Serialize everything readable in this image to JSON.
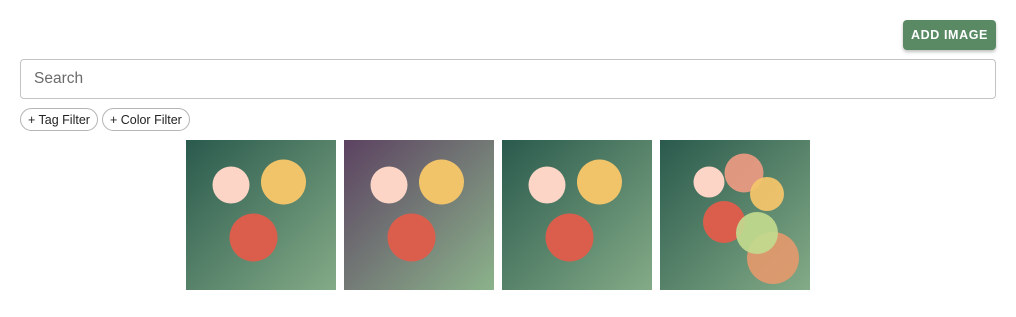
{
  "toolbar": {
    "add_image_label": "ADD IMAGE"
  },
  "search": {
    "placeholder": "Search",
    "value": ""
  },
  "filters": [
    {
      "label": "+ Tag Filter"
    },
    {
      "label": "+ Color Filter"
    }
  ],
  "colors": {
    "accent": "#5a8a64",
    "circle_pink": "#fdd5c6",
    "circle_yellow": "#f2c46a",
    "circle_red": "#db5e4d",
    "circle_salmon": "#ec9a82",
    "circle_lime": "#c2d98e",
    "circle_orange": "#e3996c"
  },
  "gallery": [
    {
      "name": "thumbnail-1",
      "gradient": [
        "#2a5a4d",
        "#84ab87"
      ]
    },
    {
      "name": "thumbnail-2",
      "gradient": [
        "#5c4261",
        "#8bb38b"
      ]
    },
    {
      "name": "thumbnail-3",
      "gradient": [
        "#2a5a4d",
        "#84ab87"
      ]
    },
    {
      "name": "thumbnail-4",
      "gradient": [
        "#2a5a4d",
        "#84ab87"
      ]
    }
  ]
}
